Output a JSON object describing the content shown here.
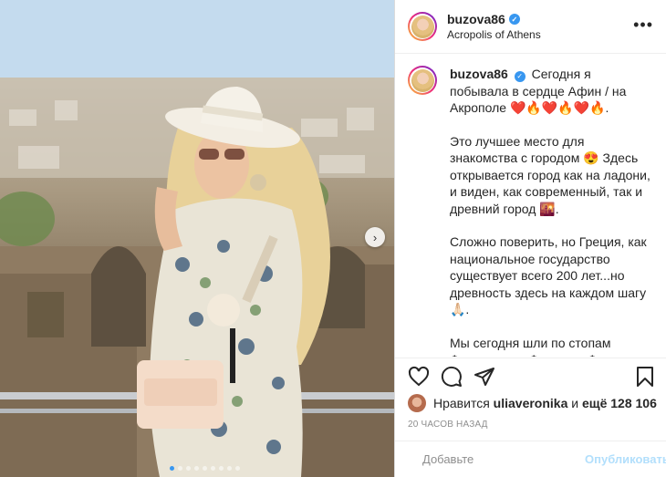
{
  "post": {
    "username": "buzova86",
    "location": "Acropolis of Athens",
    "verified_icon": "verified-badge-icon",
    "more_icon": "more-options-icon",
    "carousel": {
      "dots": 9,
      "active_index": 0,
      "next_icon": "chevron-right-icon"
    }
  },
  "caption": {
    "username": "buzova86",
    "paragraphs": [
      "Сегодня я побывала в сердце Афин / на Акрополе ❤️🔥❤️🔥❤️🔥.",
      "Это лучшее место для знакомства с городом 😍 Здесь открывается город как на ладони, и виден, как современный, так и древний город 🌇.",
      "Сложно поверить, но Греция, как национальное государство существует всего 200 лет...но древность здесь на каждом шагу🙏🏻.",
      "Мы сегодня шли по стопам Фемистокла, Ферикла, Фидия и Сократа 🙌🏻 Масштаб восхищает 🏛 больше в моих сторис 🥰"
    ]
  },
  "actions": {
    "like_icon": "heart-icon",
    "comment_icon": "comment-icon",
    "share_icon": "share-icon",
    "save_icon": "bookmark-icon"
  },
  "likes": {
    "prefix": "Нравится",
    "user": "uliaveronika",
    "middle": "и",
    "count": "ещё 128 106"
  },
  "timestamp": "20 ЧАСОВ НАЗАД",
  "comment_box": {
    "emoji_icon": "smiley-icon",
    "placeholder": "Добавьте комментарий...",
    "visible_placeholder": "Добавьте",
    "publish": "Опубликовать"
  },
  "colors": {
    "accent": "#3897f0",
    "publish_disabled": "#b2dffc",
    "border": "#dbdbdb"
  }
}
